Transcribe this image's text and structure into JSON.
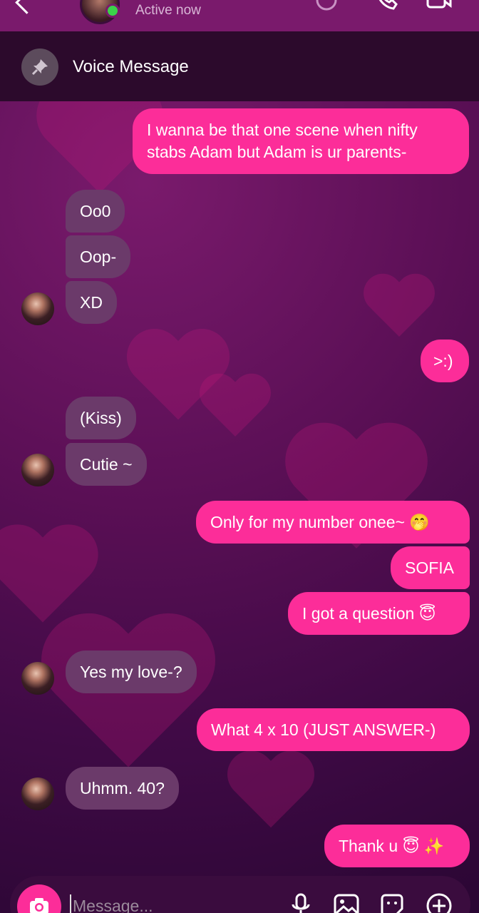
{
  "header": {
    "status": "Active now",
    "icons": [
      "back-icon",
      "sticker-icon",
      "phone-icon",
      "video-icon"
    ]
  },
  "pinned": {
    "title": "Voice Message",
    "icon": "pin-icon"
  },
  "messages": [
    {
      "side": "sent",
      "text": "I wanna be that one scene when nifty stabs Adam but Adam is ur parents-"
    },
    {
      "side": "received",
      "text": "Oo0"
    },
    {
      "side": "received",
      "text": "Oop-"
    },
    {
      "side": "received",
      "text": "XD"
    },
    {
      "side": "sent",
      "text": ">:)"
    },
    {
      "side": "received",
      "text": "(Kiss)"
    },
    {
      "side": "received",
      "text": "Cutie ~"
    },
    {
      "side": "sent",
      "text": "Only for my number onee~ 🤭"
    },
    {
      "side": "sent",
      "text": "SOFIA"
    },
    {
      "side": "sent",
      "text": "I got a question 😇"
    },
    {
      "side": "received",
      "text": "Yes my love-?"
    },
    {
      "side": "sent",
      "text": "What 4 x 10 (JUST ANSWER-)"
    },
    {
      "side": "received",
      "text": "Uhmm. 40?"
    },
    {
      "side": "sent",
      "text": "Thank u 😇 ✨"
    }
  ],
  "composer": {
    "placeholder": "Message...",
    "icons": [
      "camera-icon",
      "microphone-icon",
      "gallery-icon",
      "sticker-icon",
      "add-icon"
    ]
  },
  "colors": {
    "sent_bubble": "#fc2d99",
    "received_bubble": "#6b3a6a",
    "header": "#7a1a6c",
    "pinned_bar": "#2c0a2c"
  }
}
